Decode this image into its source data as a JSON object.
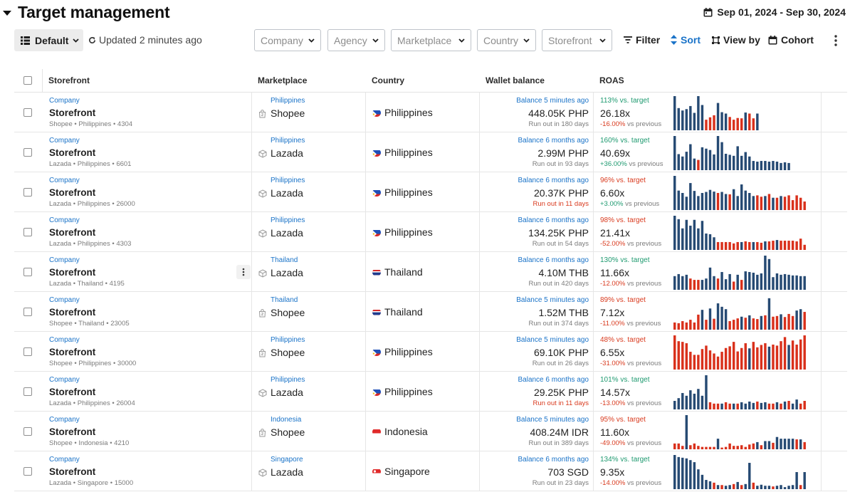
{
  "header": {
    "title": "Target management",
    "date_range": "Sep 01, 2024 - Sep 30, 2024"
  },
  "toolbar": {
    "view_label": "Default",
    "updated_text": "Updated 2 minutes ago",
    "filters": [
      "Company",
      "Agency",
      "Marketplace",
      "Country",
      "Storefront"
    ],
    "filter_label": "Filter",
    "sort_label": "Sort",
    "view_by_label": "View by",
    "cohort_label": "Cohort"
  },
  "table": {
    "columns": [
      "Storefront",
      "Marketplace",
      "Country",
      "Wallet balance",
      "ROAS"
    ],
    "colors": {
      "above_target": "#264a73",
      "below_target": "#d9301b",
      "link": "#1a73c8"
    },
    "rows": [
      {
        "company": "Company",
        "storefront": "Storefront",
        "meta": "Shopee • Philippines • 4304",
        "marketplace": "Shopee",
        "marketplace_icon": "shopee-bag-icon",
        "marketplace_country": "Philippines",
        "country": "Philippines",
        "flag": "philippines-flag-icon",
        "balance_updated": "Balance 5 minutes ago",
        "balance": "448.05K PHP",
        "run_out": "Run out in 180 days",
        "run_out_alert": false,
        "vs_target": "113% vs. target",
        "target_status": "pos",
        "roas": "26.18x",
        "delta": "-16.00%",
        "delta_status": "neg",
        "delta_suffix": " vs previous",
        "spark": [
          1.0,
          0.65,
          0.58,
          0.62,
          0.71,
          0.51,
          1.0,
          0.74,
          0.31,
          0.38,
          0.44,
          0.8,
          0.53,
          0.49,
          0.39,
          0.31,
          0.36,
          0.35,
          0.52,
          0.49,
          0.35,
          0.49
        ],
        "spark_above": [
          1,
          1,
          1,
          1,
          1,
          1,
          1,
          1,
          0,
          0,
          0,
          1,
          1,
          1,
          0,
          0,
          0,
          0,
          1,
          0,
          0,
          1
        ]
      },
      {
        "company": "Company",
        "storefront": "Storefront",
        "meta": "Lazada • Philippines • 6601",
        "marketplace": "Lazada",
        "marketplace_icon": "lazada-box-icon",
        "marketplace_country": "Philippines",
        "country": "Philippines",
        "flag": "philippines-flag-icon",
        "balance_updated": "Balance 6 months ago",
        "balance": "2.99M PHP",
        "run_out": "Run out in 93 days",
        "run_out_alert": false,
        "vs_target": "160% vs. target",
        "target_status": "pos",
        "roas": "40.69x",
        "delta": "+36.00%",
        "delta_status": "pos",
        "delta_suffix": " vs previous",
        "spark": [
          1.0,
          0.47,
          0.4,
          0.54,
          0.76,
          0.34,
          0.3,
          0.67,
          0.63,
          0.59,
          0.46,
          1.0,
          0.82,
          0.48,
          0.45,
          0.42,
          0.7,
          0.42,
          0.53,
          0.4,
          0.27,
          0.25,
          0.27,
          0.27,
          0.25,
          0.27,
          0.25,
          0.21,
          0.23,
          0.21
        ],
        "spark_above": [
          1,
          1,
          1,
          1,
          1,
          1,
          0,
          1,
          1,
          1,
          1,
          1,
          1,
          1,
          1,
          1,
          1,
          1,
          1,
          1,
          1,
          1,
          1,
          1,
          1,
          1,
          1,
          1,
          1,
          1
        ]
      },
      {
        "company": "Company",
        "storefront": "Storefront",
        "meta": "Lazada • Philippines • 26000",
        "marketplace": "Lazada",
        "marketplace_icon": "lazada-box-icon",
        "marketplace_country": "Philippines",
        "country": "Philippines",
        "flag": "philippines-flag-icon",
        "balance_updated": "Balance 6 months ago",
        "balance": "20.37K PHP",
        "run_out": "Run out in 11 days",
        "run_out_alert": true,
        "vs_target": "96% vs. target",
        "target_status": "neg",
        "roas": "6.60x",
        "delta": "+3.00%",
        "delta_status": "pos",
        "delta_suffix": " vs previous",
        "spark": [
          1.0,
          0.57,
          0.5,
          0.39,
          0.79,
          0.56,
          0.41,
          0.5,
          0.53,
          0.59,
          0.54,
          0.5,
          0.53,
          0.47,
          0.46,
          0.61,
          0.41,
          0.75,
          0.57,
          0.5,
          0.41,
          0.43,
          0.39,
          0.41,
          0.47,
          0.36,
          0.36,
          0.41,
          0.39,
          0.43,
          0.29,
          0.43,
          0.36,
          0.25
        ],
        "spark_above": [
          1,
          1,
          1,
          1,
          1,
          1,
          1,
          1,
          1,
          1,
          1,
          0,
          1,
          1,
          0,
          1,
          1,
          1,
          1,
          1,
          1,
          0,
          0,
          1,
          0,
          1,
          0,
          1,
          0,
          0,
          0,
          0,
          0,
          0
        ]
      },
      {
        "company": "Company",
        "storefront": "Storefront",
        "meta": "Lazada • Philippines • 4303",
        "marketplace": "Lazada",
        "marketplace_icon": "lazada-box-icon",
        "marketplace_country": "Philippines",
        "country": "Philippines",
        "flag": "philippines-flag-icon",
        "balance_updated": "Balance 6 months ago",
        "balance": "134.25K PHP",
        "run_out": "Run out in 54 days",
        "run_out_alert": false,
        "vs_target": "98% vs. target",
        "target_status": "neg",
        "roas": "21.41x",
        "delta": "-52.00%",
        "delta_status": "neg",
        "delta_suffix": " vs previous",
        "spark": [
          1.0,
          0.9,
          0.63,
          0.88,
          0.71,
          0.88,
          0.63,
          0.85,
          0.48,
          0.46,
          0.37,
          0.23,
          0.23,
          0.23,
          0.23,
          0.19,
          0.23,
          0.23,
          0.25,
          0.23,
          0.23,
          0.23,
          0.21,
          0.25,
          0.25,
          0.27,
          0.29,
          0.27,
          0.27,
          0.27,
          0.27,
          0.25,
          0.33,
          0.15
        ],
        "spark_above": [
          1,
          1,
          1,
          1,
          1,
          1,
          1,
          1,
          1,
          1,
          1,
          0,
          0,
          0,
          0,
          0,
          0,
          1,
          0,
          0,
          1,
          0,
          0,
          1,
          0,
          0,
          1,
          0,
          0,
          0,
          0,
          0,
          0,
          0
        ]
      },
      {
        "company": "Company",
        "storefront": "Storefront",
        "meta": "Lazada • Thailand • 4195",
        "marketplace": "Lazada",
        "marketplace_icon": "lazada-box-icon",
        "marketplace_country": "Thailand",
        "country": "Thailand",
        "flag": "thailand-flag-icon",
        "balance_updated": "Balance 6 months ago",
        "balance": "4.10M THB",
        "run_out": "Run out in 420 days",
        "run_out_alert": false,
        "vs_target": "130% vs. target",
        "target_status": "pos",
        "roas": "11.66x",
        "delta": "-12.00%",
        "delta_status": "neg",
        "delta_suffix": " vs previous",
        "spark": [
          0.4,
          0.46,
          0.4,
          0.44,
          0.33,
          0.29,
          0.29,
          0.29,
          0.33,
          0.65,
          0.4,
          0.33,
          0.52,
          0.31,
          0.46,
          0.24,
          0.44,
          0.29,
          0.54,
          0.52,
          0.5,
          0.44,
          0.48,
          1.0,
          0.9,
          0.37,
          0.48,
          0.44,
          0.46,
          0.44,
          0.42,
          0.42,
          0.4,
          0.4
        ],
        "spark_above": [
          1,
          1,
          1,
          1,
          0,
          0,
          0,
          1,
          1,
          1,
          1,
          0,
          1,
          1,
          1,
          0,
          1,
          0,
          1,
          1,
          1,
          1,
          1,
          1,
          1,
          1,
          1,
          1,
          1,
          1,
          1,
          1,
          1,
          1
        ]
      },
      {
        "company": "Company",
        "storefront": "Storefront",
        "meta": "Shopee • Thailand • 23005",
        "marketplace": "Shopee",
        "marketplace_icon": "shopee-bag-icon",
        "marketplace_country": "Thailand",
        "country": "Thailand",
        "flag": "thailand-flag-icon",
        "balance_updated": "Balance 5 minutes ago",
        "balance": "1.52M THB",
        "run_out": "Run out in 374 days",
        "run_out_alert": false,
        "vs_target": "89% vs. target",
        "target_status": "neg",
        "roas": "7.12x",
        "delta": "-11.00%",
        "delta_status": "neg",
        "delta_suffix": " vs previous",
        "spark": [
          0.21,
          0.19,
          0.25,
          0.21,
          0.29,
          0.21,
          0.44,
          0.58,
          0.29,
          0.62,
          0.32,
          0.77,
          0.67,
          0.6,
          0.25,
          0.29,
          0.33,
          0.38,
          0.35,
          0.42,
          0.33,
          0.31,
          0.4,
          0.42,
          0.92,
          0.38,
          0.4,
          0.45,
          0.37,
          0.46,
          0.4,
          0.56,
          0.6,
          0.52,
          0.42,
          0.38,
          0.6,
          0.49,
          0.56
        ],
        "spark_above": [
          0,
          0,
          0,
          0,
          0,
          0,
          0,
          1,
          0,
          1,
          0,
          1,
          1,
          1,
          0,
          0,
          0,
          1,
          0,
          1,
          0,
          0,
          1,
          0,
          1,
          0,
          0,
          1,
          0,
          0,
          0,
          1,
          1,
          0,
          0,
          0,
          1,
          0,
          0
        ]
      },
      {
        "company": "Company",
        "storefront": "Storefront",
        "meta": "Shopee • Philippines • 30000",
        "marketplace": "Shopee",
        "marketplace_icon": "shopee-bag-icon",
        "marketplace_country": "Philippines",
        "country": "Philippines",
        "flag": "philippines-flag-icon",
        "balance_updated": "Balance 5 minutes ago",
        "balance": "69.10K PHP",
        "run_out": "Run out in 26 days",
        "run_out_alert": false,
        "vs_target": "48% vs. target",
        "target_status": "neg",
        "roas": "6.55x",
        "delta": "-31.00%",
        "delta_status": "neg",
        "delta_suffix": " vs previous",
        "spark": [
          1.0,
          0.83,
          0.81,
          0.77,
          0.52,
          0.43,
          0.43,
          0.6,
          0.7,
          0.56,
          0.47,
          0.38,
          0.52,
          0.63,
          0.68,
          0.81,
          0.53,
          0.63,
          0.77,
          0.62,
          0.81,
          0.65,
          0.72,
          0.77,
          0.67,
          0.73,
          0.7,
          0.83,
          0.95,
          0.72,
          0.85,
          0.73,
          0.88,
          1.0
        ],
        "spark_above": [
          0,
          0,
          0,
          0,
          0,
          0,
          0,
          0,
          0,
          0,
          0,
          0,
          0,
          0,
          0,
          0,
          0,
          0,
          0,
          1,
          0,
          0,
          0,
          0,
          1,
          0,
          0,
          0,
          0,
          1,
          0,
          0,
          0,
          0
        ]
      },
      {
        "company": "Company",
        "storefront": "Storefront",
        "meta": "Lazada • Philippines • 26004",
        "marketplace": "Lazada",
        "marketplace_icon": "lazada-box-icon",
        "marketplace_country": "Philippines",
        "country": "Philippines",
        "flag": "philippines-flag-icon",
        "balance_updated": "Balance 6 months ago",
        "balance": "29.25K PHP",
        "run_out": "Run out in 11 days",
        "run_out_alert": true,
        "vs_target": "101% vs. target",
        "target_status": "pos",
        "roas": "14.57x",
        "delta": "-13.00%",
        "delta_status": "neg",
        "delta_suffix": " vs previous",
        "spark": [
          0.25,
          0.33,
          0.48,
          0.4,
          0.56,
          0.46,
          0.6,
          0.4,
          1.0,
          0.21,
          0.17,
          0.17,
          0.17,
          0.21,
          0.17,
          0.17,
          0.17,
          0.21,
          0.17,
          0.23,
          0.19,
          0.23,
          0.19,
          0.21,
          0.17,
          0.17,
          0.21,
          0.17,
          0.23,
          0.25,
          0.17,
          0.29,
          0.17,
          0.25,
          0.21,
          0.17,
          0.21,
          0.17
        ],
        "spark_above": [
          1,
          1,
          1,
          1,
          1,
          1,
          1,
          1,
          1,
          0,
          0,
          0,
          1,
          0,
          0,
          1,
          0,
          1,
          1,
          1,
          1,
          0,
          1,
          1,
          0,
          0,
          1,
          0,
          1,
          0,
          1,
          1,
          0,
          0,
          0,
          1,
          0,
          0
        ]
      },
      {
        "company": "Company",
        "storefront": "Storefront",
        "meta": "Shopee • Indonesia • 4210",
        "marketplace": "Shopee",
        "marketplace_icon": "shopee-bag-icon",
        "marketplace_country": "Indonesia",
        "country": "Indonesia",
        "flag": "indonesia-flag-icon",
        "balance_updated": "Balance 5 minutes ago",
        "balance": "408.24M IDR",
        "run_out": "Run out in 389 days",
        "run_out_alert": false,
        "vs_target": "95% vs. target",
        "target_status": "neg",
        "roas": "11.60x",
        "delta": "-49.00%",
        "delta_status": "neg",
        "delta_suffix": " vs previous",
        "spark": [
          0.17,
          0.17,
          0.1,
          1.0,
          0.12,
          0.17,
          0.1,
          0.07,
          0.07,
          0.07,
          0.07,
          0.31,
          0.05,
          0.07,
          0.17,
          0.1,
          0.1,
          0.12,
          0.07,
          0.14,
          0.17,
          0.21,
          0.12,
          0.24,
          0.24,
          0.19,
          0.36,
          0.31,
          0.31,
          0.31,
          0.31,
          0.29,
          0.29,
          0.21,
          0.21,
          0.17,
          0.17,
          0.17
        ],
        "spark_above": [
          0,
          0,
          0,
          1,
          0,
          0,
          0,
          0,
          0,
          0,
          0,
          1,
          0,
          0,
          0,
          0,
          0,
          0,
          0,
          0,
          0,
          1,
          0,
          1,
          1,
          0,
          1,
          1,
          1,
          1,
          1,
          0,
          1,
          0,
          0,
          0,
          0,
          0
        ]
      },
      {
        "company": "Company",
        "storefront": "Storefront",
        "meta": "Lazada • Singapore • 15000",
        "marketplace": "Lazada",
        "marketplace_icon": "lazada-box-icon",
        "marketplace_country": "Singapore",
        "country": "Singapore",
        "flag": "singapore-flag-icon",
        "balance_updated": "Balance 6 months ago",
        "balance": "703 SGD",
        "run_out": "Run out in 23 days",
        "run_out_alert": false,
        "vs_target": "134% vs. target",
        "target_status": "pos",
        "roas": "9.35x",
        "delta": "-14.00%",
        "delta_status": "neg",
        "delta_suffix": " vs previous",
        "spark": [
          1.0,
          0.94,
          0.92,
          0.9,
          0.85,
          0.79,
          0.58,
          0.42,
          0.27,
          0.23,
          0.19,
          0.12,
          0.12,
          0.1,
          0.12,
          0.15,
          0.21,
          0.12,
          0.15,
          0.77,
          0.19,
          0.1,
          0.13,
          0.1,
          0.1,
          0.08,
          0.1,
          0.12,
          0.06,
          0.1,
          0.12,
          0.5,
          0.12,
          0.5,
          0.12,
          0.1,
          0.4,
          0.1
        ],
        "spark_above": [
          1,
          1,
          1,
          1,
          1,
          1,
          1,
          1,
          1,
          1,
          0,
          1,
          0,
          1,
          1,
          0,
          1,
          0,
          1,
          1,
          0,
          1,
          1,
          1,
          1,
          0,
          1,
          1,
          1,
          1,
          1,
          1,
          0,
          1,
          1,
          1,
          1,
          1
        ]
      }
    ]
  }
}
